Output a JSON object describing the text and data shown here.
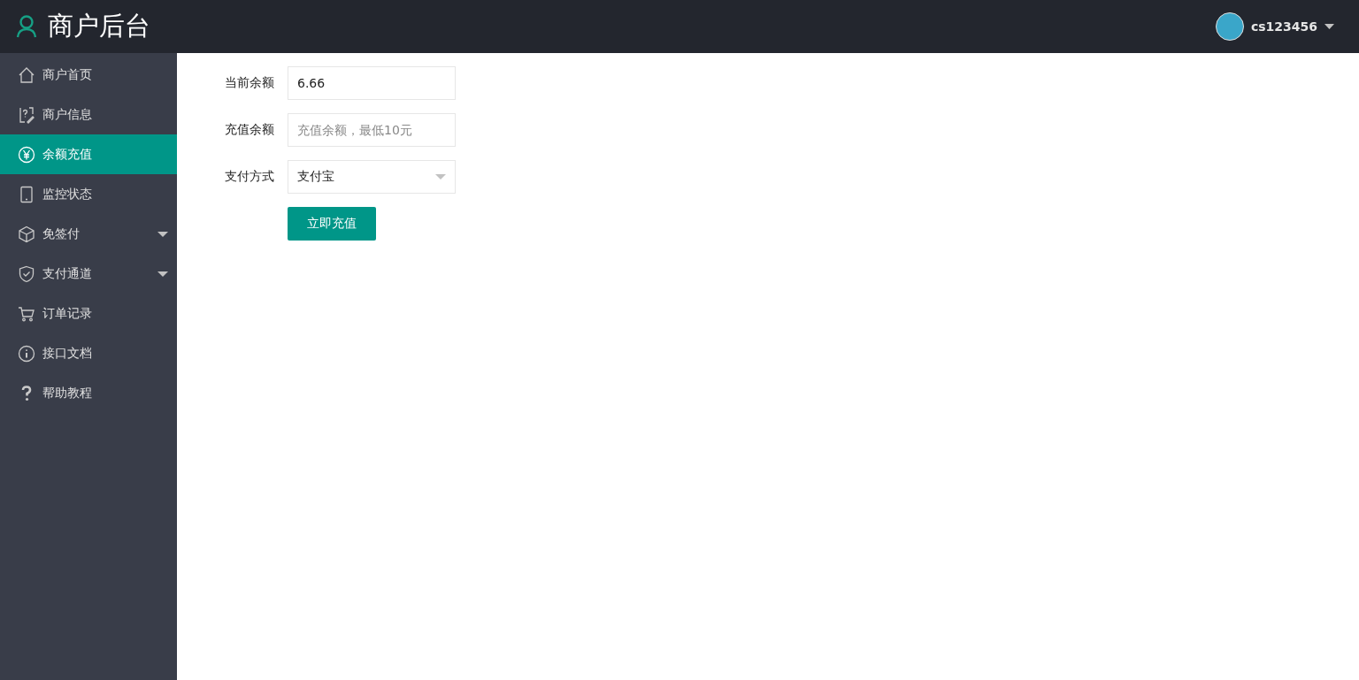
{
  "header": {
    "title": "商户后台",
    "user": {
      "name": "cs123456"
    }
  },
  "sidebar": {
    "items": [
      {
        "label": "商户首页",
        "kind": "home",
        "selected": false,
        "has_submenu": false
      },
      {
        "label": "商户信息",
        "kind": "info-edit",
        "selected": false,
        "has_submenu": false
      },
      {
        "label": "余额充值",
        "kind": "yen",
        "selected": true,
        "has_submenu": false
      },
      {
        "label": "监控状态",
        "kind": "phone",
        "selected": false,
        "has_submenu": false
      },
      {
        "label": "免签付",
        "kind": "cube",
        "selected": false,
        "has_submenu": true
      },
      {
        "label": "支付通道",
        "kind": "shield",
        "selected": false,
        "has_submenu": true
      },
      {
        "label": "订单记录",
        "kind": "cart",
        "selected": false,
        "has_submenu": false
      },
      {
        "label": "接口文档",
        "kind": "info",
        "selected": false,
        "has_submenu": false
      },
      {
        "label": "帮助教程",
        "kind": "question",
        "selected": false,
        "has_submenu": false
      }
    ]
  },
  "form": {
    "fields": [
      {
        "kind": "text",
        "label": "当前余额",
        "value": "6.66"
      },
      {
        "kind": "text",
        "label": "充值余额",
        "placeholder": "充值余额，最低10元"
      },
      {
        "kind": "select",
        "label": "支付方式",
        "value": "支付宝"
      }
    ],
    "submit": "立即充值"
  }
}
